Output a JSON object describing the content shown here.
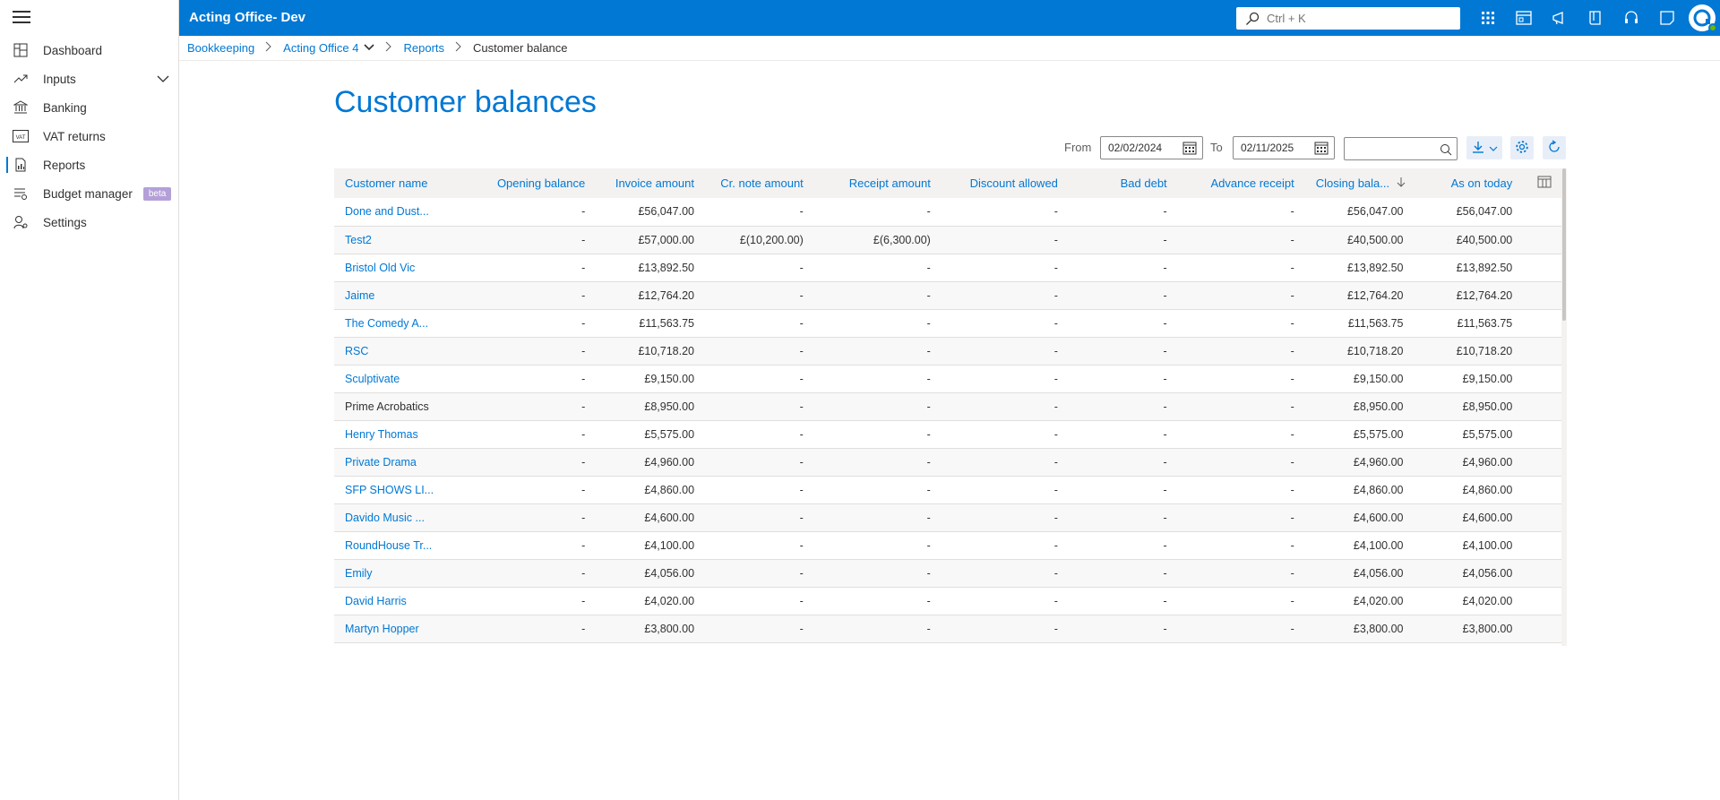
{
  "app": {
    "title": "Acting Office- Dev",
    "search_placeholder": "Ctrl + K"
  },
  "sidebar": {
    "items": [
      {
        "label": "Dashboard",
        "icon": "dashboard-icon"
      },
      {
        "label": "Inputs",
        "icon": "trend-icon"
      },
      {
        "label": "Banking",
        "icon": "bank-icon"
      },
      {
        "label": "VAT returns",
        "icon": "vat-icon"
      },
      {
        "label": "Reports",
        "icon": "report-icon"
      },
      {
        "label": "Budget manager",
        "icon": "budget-icon",
        "badge": "beta"
      },
      {
        "label": "Settings",
        "icon": "settings-user-icon"
      }
    ]
  },
  "breadcrumb": {
    "items": [
      "Bookkeeping",
      "Acting Office 4",
      "Reports"
    ],
    "current": "Customer balance"
  },
  "page": {
    "title": "Customer balances"
  },
  "filters": {
    "from_label": "From",
    "from_value": "02/02/2024",
    "to_label": "To",
    "to_value": "02/11/2025",
    "search_value": ""
  },
  "table": {
    "columns": [
      "Customer name",
      "Opening balance",
      "Invoice amount",
      "Cr. note amount",
      "Receipt amount",
      "Discount allowed",
      "Bad debt",
      "Advance receipt",
      "Closing bala...",
      "As on today"
    ],
    "rows": [
      {
        "name": "Done and Dust...",
        "link": true,
        "opening": "-",
        "invoice": "£56,047.00",
        "crnote": "-",
        "receipt": "-",
        "discount": "-",
        "baddebt": "-",
        "advance": "-",
        "closing": "£56,047.00",
        "today": "£56,047.00"
      },
      {
        "name": "Test2",
        "link": true,
        "opening": "-",
        "invoice": "£57,000.00",
        "crnote": "£(10,200.00)",
        "receipt": "£(6,300.00)",
        "discount": "-",
        "baddebt": "-",
        "advance": "-",
        "closing": "£40,500.00",
        "today": "£40,500.00"
      },
      {
        "name": "Bristol Old Vic",
        "link": true,
        "opening": "-",
        "invoice": "£13,892.50",
        "crnote": "-",
        "receipt": "-",
        "discount": "-",
        "baddebt": "-",
        "advance": "-",
        "closing": "£13,892.50",
        "today": "£13,892.50"
      },
      {
        "name": "Jaime",
        "link": true,
        "opening": "-",
        "invoice": "£12,764.20",
        "crnote": "-",
        "receipt": "-",
        "discount": "-",
        "baddebt": "-",
        "advance": "-",
        "closing": "£12,764.20",
        "today": "£12,764.20"
      },
      {
        "name": "The Comedy A...",
        "link": true,
        "opening": "-",
        "invoice": "£11,563.75",
        "crnote": "-",
        "receipt": "-",
        "discount": "-",
        "baddebt": "-",
        "advance": "-",
        "closing": "£11,563.75",
        "today": "£11,563.75"
      },
      {
        "name": "RSC",
        "link": true,
        "opening": "-",
        "invoice": "£10,718.20",
        "crnote": "-",
        "receipt": "-",
        "discount": "-",
        "baddebt": "-",
        "advance": "-",
        "closing": "£10,718.20",
        "today": "£10,718.20"
      },
      {
        "name": "Sculptivate",
        "link": true,
        "opening": "-",
        "invoice": "£9,150.00",
        "crnote": "-",
        "receipt": "-",
        "discount": "-",
        "baddebt": "-",
        "advance": "-",
        "closing": "£9,150.00",
        "today": "£9,150.00"
      },
      {
        "name": "Prime Acrobatics",
        "link": false,
        "opening": "-",
        "invoice": "£8,950.00",
        "crnote": "-",
        "receipt": "-",
        "discount": "-",
        "baddebt": "-",
        "advance": "-",
        "closing": "£8,950.00",
        "today": "£8,950.00"
      },
      {
        "name": "Henry Thomas",
        "link": true,
        "opening": "-",
        "invoice": "£5,575.00",
        "crnote": "-",
        "receipt": "-",
        "discount": "-",
        "baddebt": "-",
        "advance": "-",
        "closing": "£5,575.00",
        "today": "£5,575.00"
      },
      {
        "name": "Private Drama",
        "link": true,
        "opening": "-",
        "invoice": "£4,960.00",
        "crnote": "-",
        "receipt": "-",
        "discount": "-",
        "baddebt": "-",
        "advance": "-",
        "closing": "£4,960.00",
        "today": "£4,960.00"
      },
      {
        "name": "SFP SHOWS LI...",
        "link": true,
        "opening": "-",
        "invoice": "£4,860.00",
        "crnote": "-",
        "receipt": "-",
        "discount": "-",
        "baddebt": "-",
        "advance": "-",
        "closing": "£4,860.00",
        "today": "£4,860.00"
      },
      {
        "name": "Davido Music ...",
        "link": true,
        "opening": "-",
        "invoice": "£4,600.00",
        "crnote": "-",
        "receipt": "-",
        "discount": "-",
        "baddebt": "-",
        "advance": "-",
        "closing": "£4,600.00",
        "today": "£4,600.00"
      },
      {
        "name": "RoundHouse Tr...",
        "link": true,
        "opening": "-",
        "invoice": "£4,100.00",
        "crnote": "-",
        "receipt": "-",
        "discount": "-",
        "baddebt": "-",
        "advance": "-",
        "closing": "£4,100.00",
        "today": "£4,100.00"
      },
      {
        "name": "Emily",
        "link": true,
        "opening": "-",
        "invoice": "£4,056.00",
        "crnote": "-",
        "receipt": "-",
        "discount": "-",
        "baddebt": "-",
        "advance": "-",
        "closing": "£4,056.00",
        "today": "£4,056.00"
      },
      {
        "name": "David Harris",
        "link": true,
        "opening": "-",
        "invoice": "£4,020.00",
        "crnote": "-",
        "receipt": "-",
        "discount": "-",
        "baddebt": "-",
        "advance": "-",
        "closing": "£4,020.00",
        "today": "£4,020.00"
      },
      {
        "name": "Martyn Hopper",
        "link": true,
        "opening": "-",
        "invoice": "£3,800.00",
        "crnote": "-",
        "receipt": "-",
        "discount": "-",
        "baddebt": "-",
        "advance": "-",
        "closing": "£3,800.00",
        "today": "£3,800.00"
      }
    ]
  },
  "colors": {
    "accent": "#0078d4",
    "badge": "#b4a0d8"
  }
}
